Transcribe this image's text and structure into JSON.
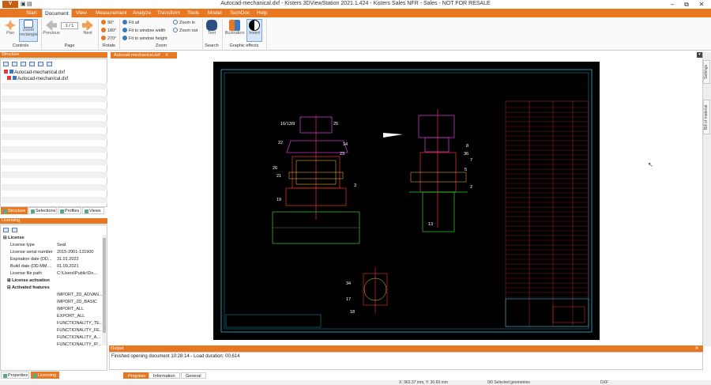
{
  "window": {
    "title": "Autocad-mechanical.dxf - Kisters 3DViewStation 2021.1.424 - Kisters Sales NFR - Sales - NOT FOR RESALE",
    "minimize": "–",
    "restore": "⧉",
    "close": "✕",
    "app_button": "V"
  },
  "ribbon_tabs": [
    "Start",
    "Document",
    "View",
    "Measurement",
    "Analyze",
    "Transform",
    "Tools",
    "Model",
    "TechDoc",
    "Help"
  ],
  "ribbon": {
    "controls": {
      "pan": "Pan",
      "zoom_rect": "Zoom rectangle",
      "group": "Controls"
    },
    "page": {
      "previous": "Previous",
      "counter": "1 / 1",
      "next": "Next",
      "group": "Page"
    },
    "rotate": {
      "r90": "90°",
      "r180": "180°",
      "r270": "270°",
      "group": "Rotate"
    },
    "zoom": {
      "fit_all": "Fit all",
      "fit_width": "Fit to window width",
      "fit_height": "Fit to window height",
      "zoom_in": "Zoom in",
      "zoom_out": "Zoom out",
      "group": "Zoom"
    },
    "search": {
      "text": "Text",
      "group": "Search"
    },
    "effects": {
      "illustration": "Illustration",
      "invert": "Invert",
      "group": "Graphic effects"
    }
  },
  "structure": {
    "header": "Structure",
    "root": "Autocad-mechanical.dxf",
    "child": "Autocad-mechanical.dxf",
    "tabs": [
      "Structure",
      "Selections",
      "Profiles",
      "Views"
    ]
  },
  "licensing": {
    "header": "Licensing",
    "section": "License",
    "rows": [
      {
        "k": "License type",
        "v": "Seat"
      },
      {
        "k": "License serial number",
        "v": "2015-2901-131900"
      },
      {
        "k": "Expiration date (DD...",
        "v": "31.01.2022"
      },
      {
        "k": "Build date (DD.MM....",
        "v": "01.09.2021"
      },
      {
        "k": "License file path",
        "v": "C:\\Users\\Public\\Do..."
      }
    ],
    "activation": "License activation",
    "features_header": "Activated features",
    "features": [
      "IMPORT_2D_ADVAN...",
      "IMPORT_2D_BASIC",
      "IMPORT_ALL",
      "EXPORT_ALL",
      "FUNCTIONALITY_TE...",
      "FUNCTIONALITY_FE...",
      "FUNCTIONALITY_A...",
      "FUNCTIONALITY_IP..."
    ],
    "bottom_tabs": [
      "Properties",
      "Licensing"
    ]
  },
  "document": {
    "tab": "Autocad-mechanical.dxf",
    "side_tabs": [
      "Settings",
      "Bill of material"
    ]
  },
  "output": {
    "header": "Output",
    "message": "Finished opening document 10:28:14 - Load duration: 00.614",
    "tabs": [
      "Progress",
      "Information",
      "General"
    ]
  },
  "status": {
    "coords": "X: 963.37 mm, Y: 30.69 mm",
    "selected": "0/0 Selected geometries",
    "format": "DXF"
  },
  "drawing_labels": [
    "16/13/9",
    "25",
    "22",
    "14",
    "23",
    "26",
    "21",
    "3",
    "19",
    "36",
    "5",
    "2",
    "13",
    "34",
    "17",
    "18",
    "8",
    "7"
  ]
}
